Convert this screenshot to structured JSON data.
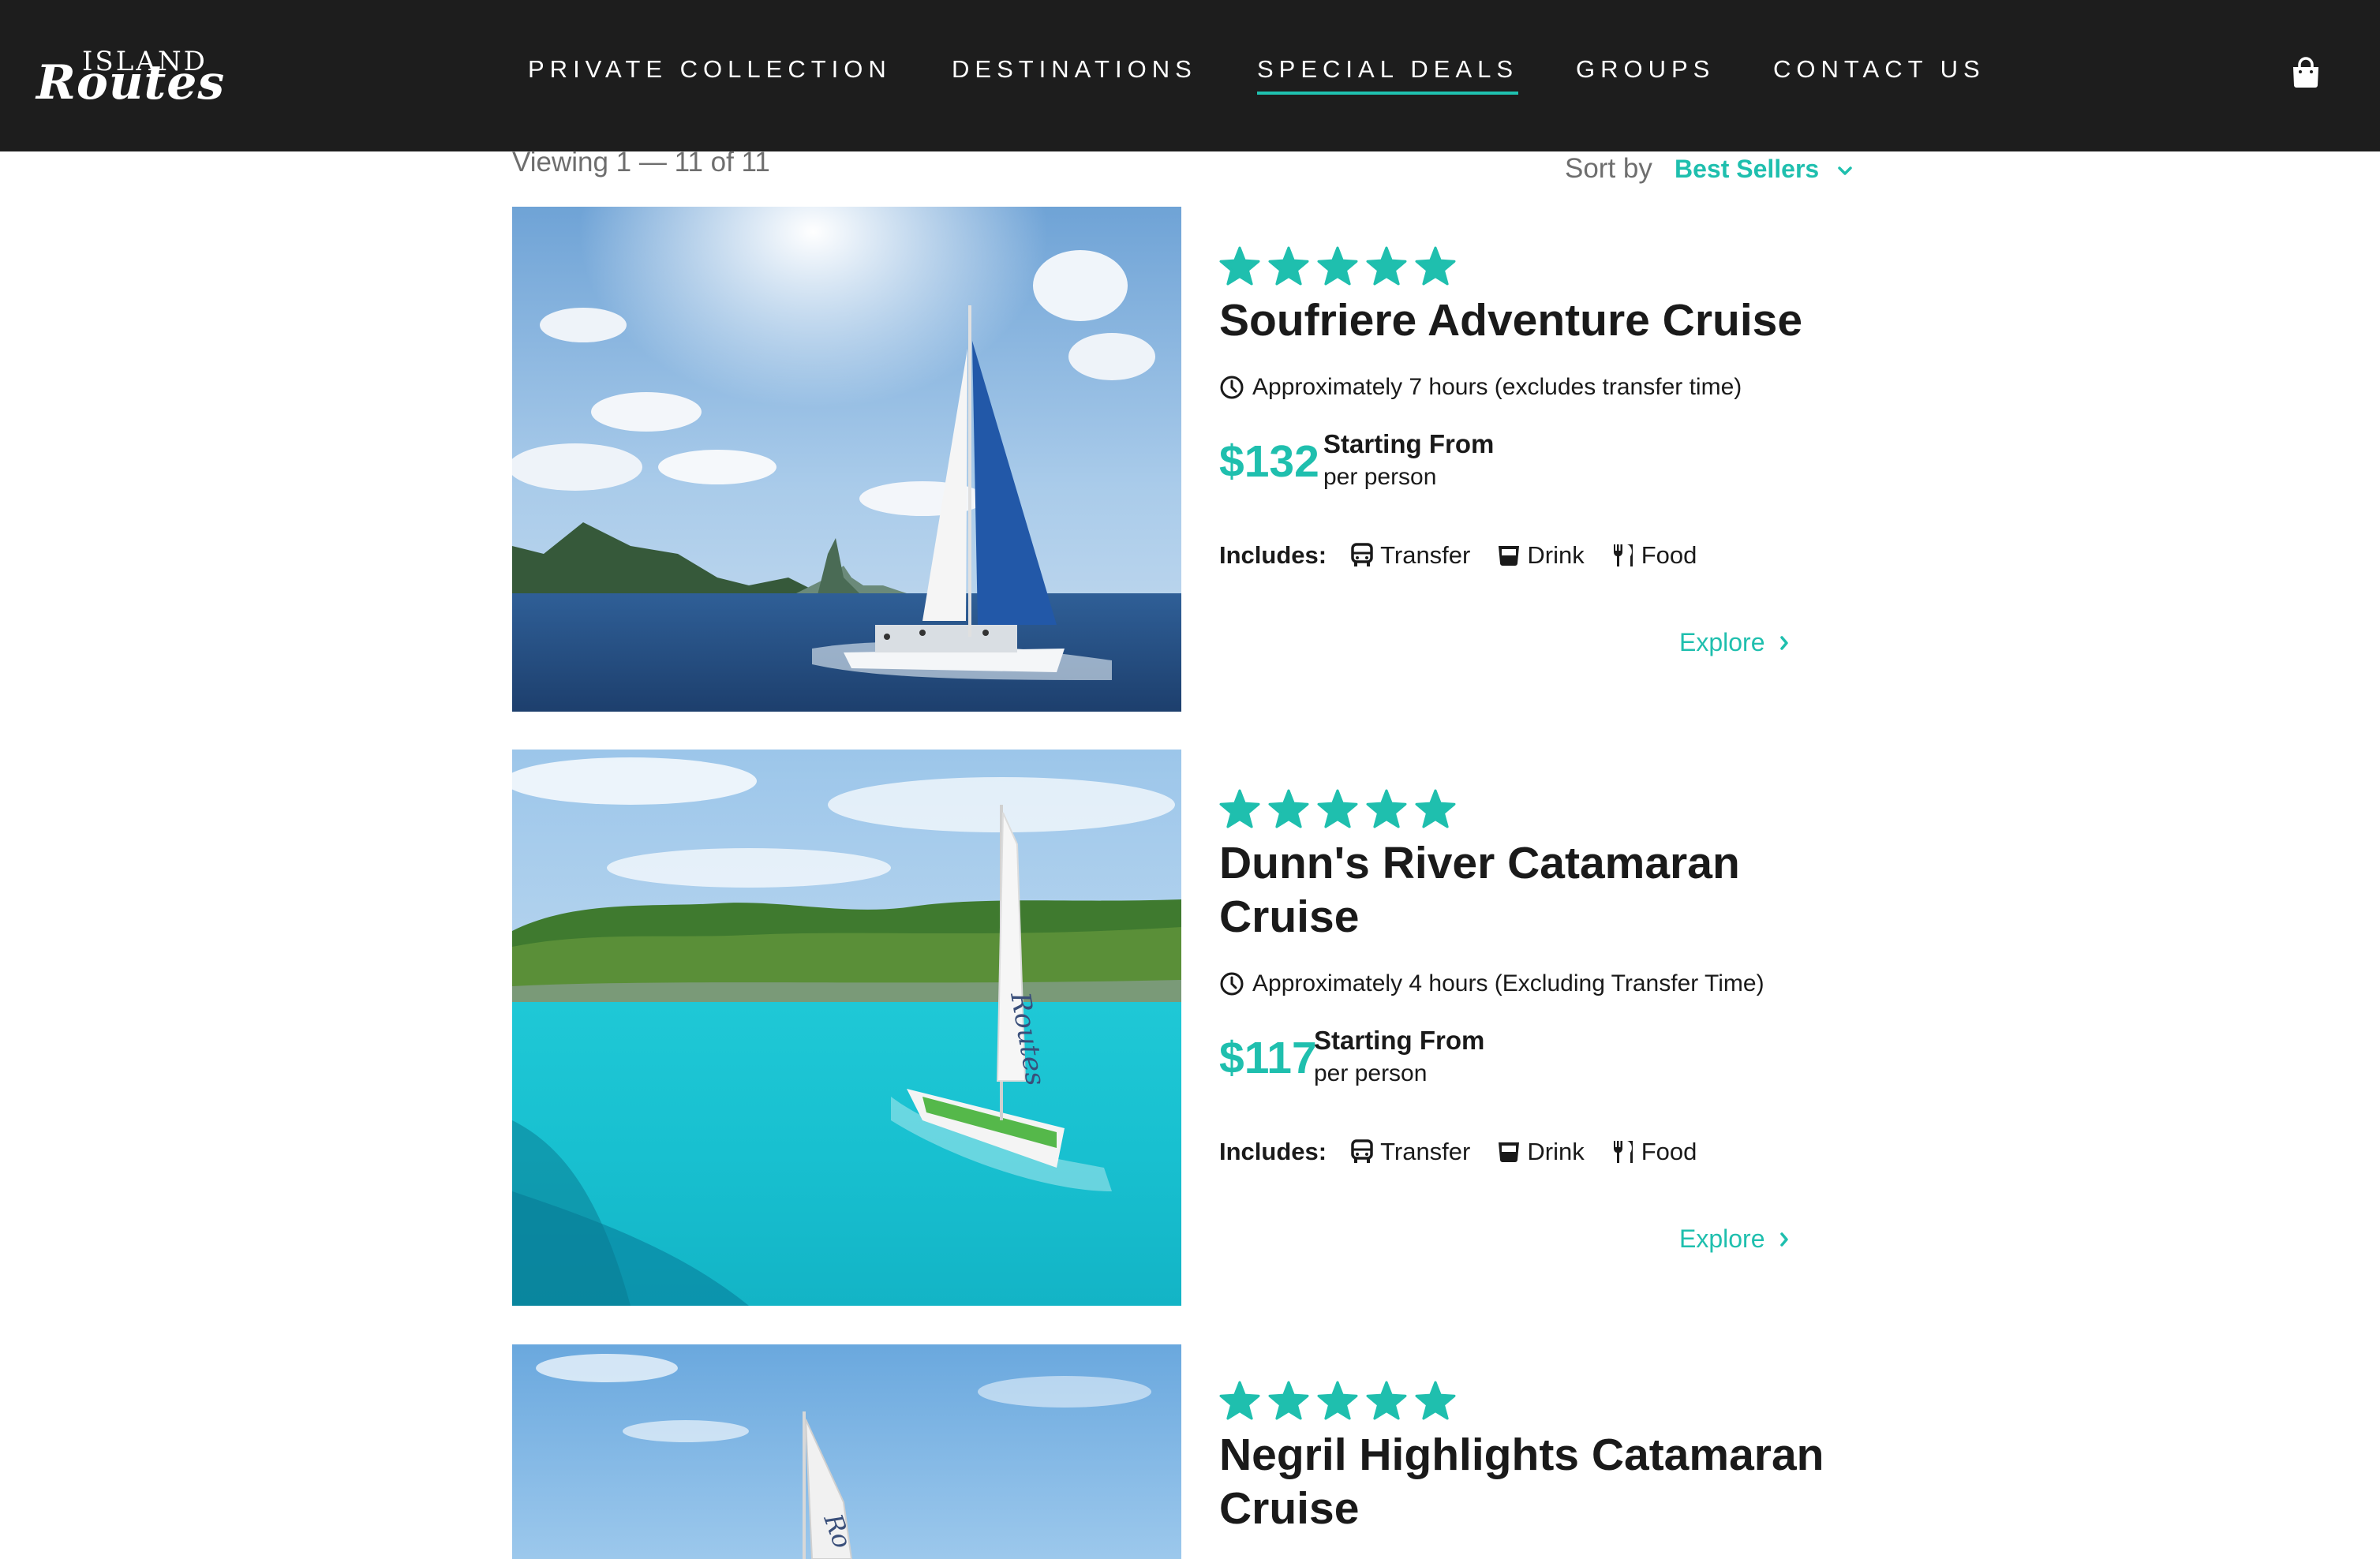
{
  "brand": {
    "logo_top": "ISLAND",
    "logo_main": "Routes"
  },
  "nav": {
    "items": [
      {
        "label": "PRIVATE COLLECTION",
        "active": false
      },
      {
        "label": "DESTINATIONS",
        "active": false
      },
      {
        "label": "SPECIAL DEALS",
        "active": true
      },
      {
        "label": "GROUPS",
        "active": false
      },
      {
        "label": "CONTACT US",
        "active": false
      }
    ],
    "cart_icon": "shopping-bag-icon"
  },
  "toolbar": {
    "viewing": "Viewing  1 — 11 of 11",
    "sort_label": "Sort by",
    "sort_value": "Best Sellers"
  },
  "colors": {
    "accent": "#1fbfae",
    "header_bg": "#1d1d1d",
    "text": "#1a1a1a"
  },
  "tours": [
    {
      "rating_stars": 5,
      "title": "Soufriere Adventure Cruise",
      "duration": "Approximately 7 hours (excludes transfer time)",
      "price": "$132",
      "price_label": "Starting From",
      "price_sub": "per person",
      "includes_label": "Includes:",
      "includes": [
        "Transfer",
        "Drink",
        "Food"
      ],
      "explore": "Explore"
    },
    {
      "rating_stars": 5,
      "title": "Dunn's River Catamaran Cruise",
      "duration": "Approximately 4 hours (Excluding Transfer Time)",
      "price": "$117",
      "price_label": "Starting From",
      "price_sub": "per person",
      "includes_label": "Includes:",
      "includes": [
        "Transfer",
        "Drink",
        "Food"
      ],
      "explore": "Explore"
    },
    {
      "rating_stars": 5,
      "title": "Negril Highlights Catamaran Cruise"
    }
  ]
}
